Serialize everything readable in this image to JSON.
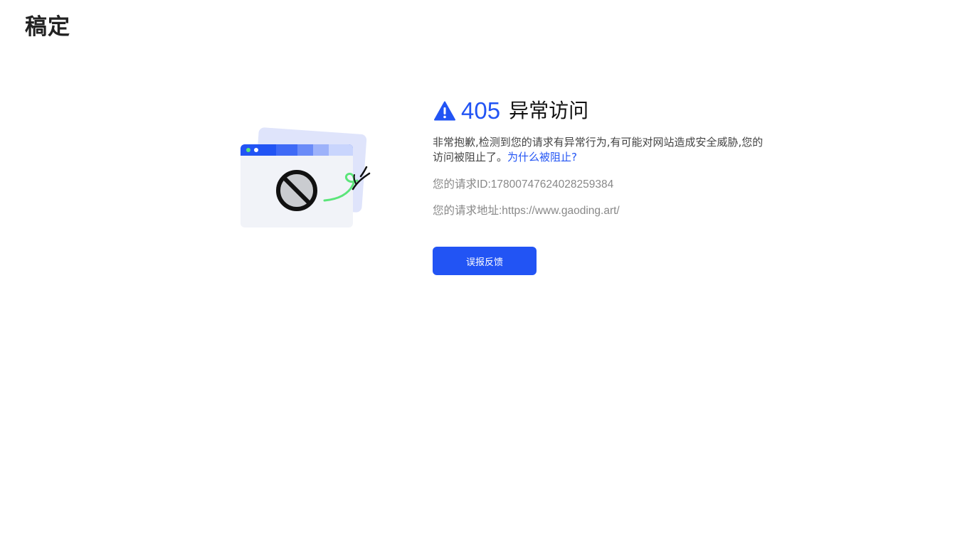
{
  "header": {
    "logo_text": "稿定"
  },
  "error": {
    "icon": "warning-triangle-icon",
    "code": "405",
    "title": "异常访问",
    "description": "非常抱歉,检测到您的请求有异常行为,有可能对网站造成安全威胁,您的访问被阻止了。",
    "why_link": "为什么被阻止?",
    "request_id_line": "您的请求ID:17800747624028259384",
    "request_url_line": "您的请求地址:https://www.gaoding.art/",
    "feedback_button": "误报反馈"
  },
  "colors": {
    "accent": "#2254f4",
    "text_dark": "#111111",
    "text_muted": "#888888",
    "illustration_green": "#5be57a"
  }
}
